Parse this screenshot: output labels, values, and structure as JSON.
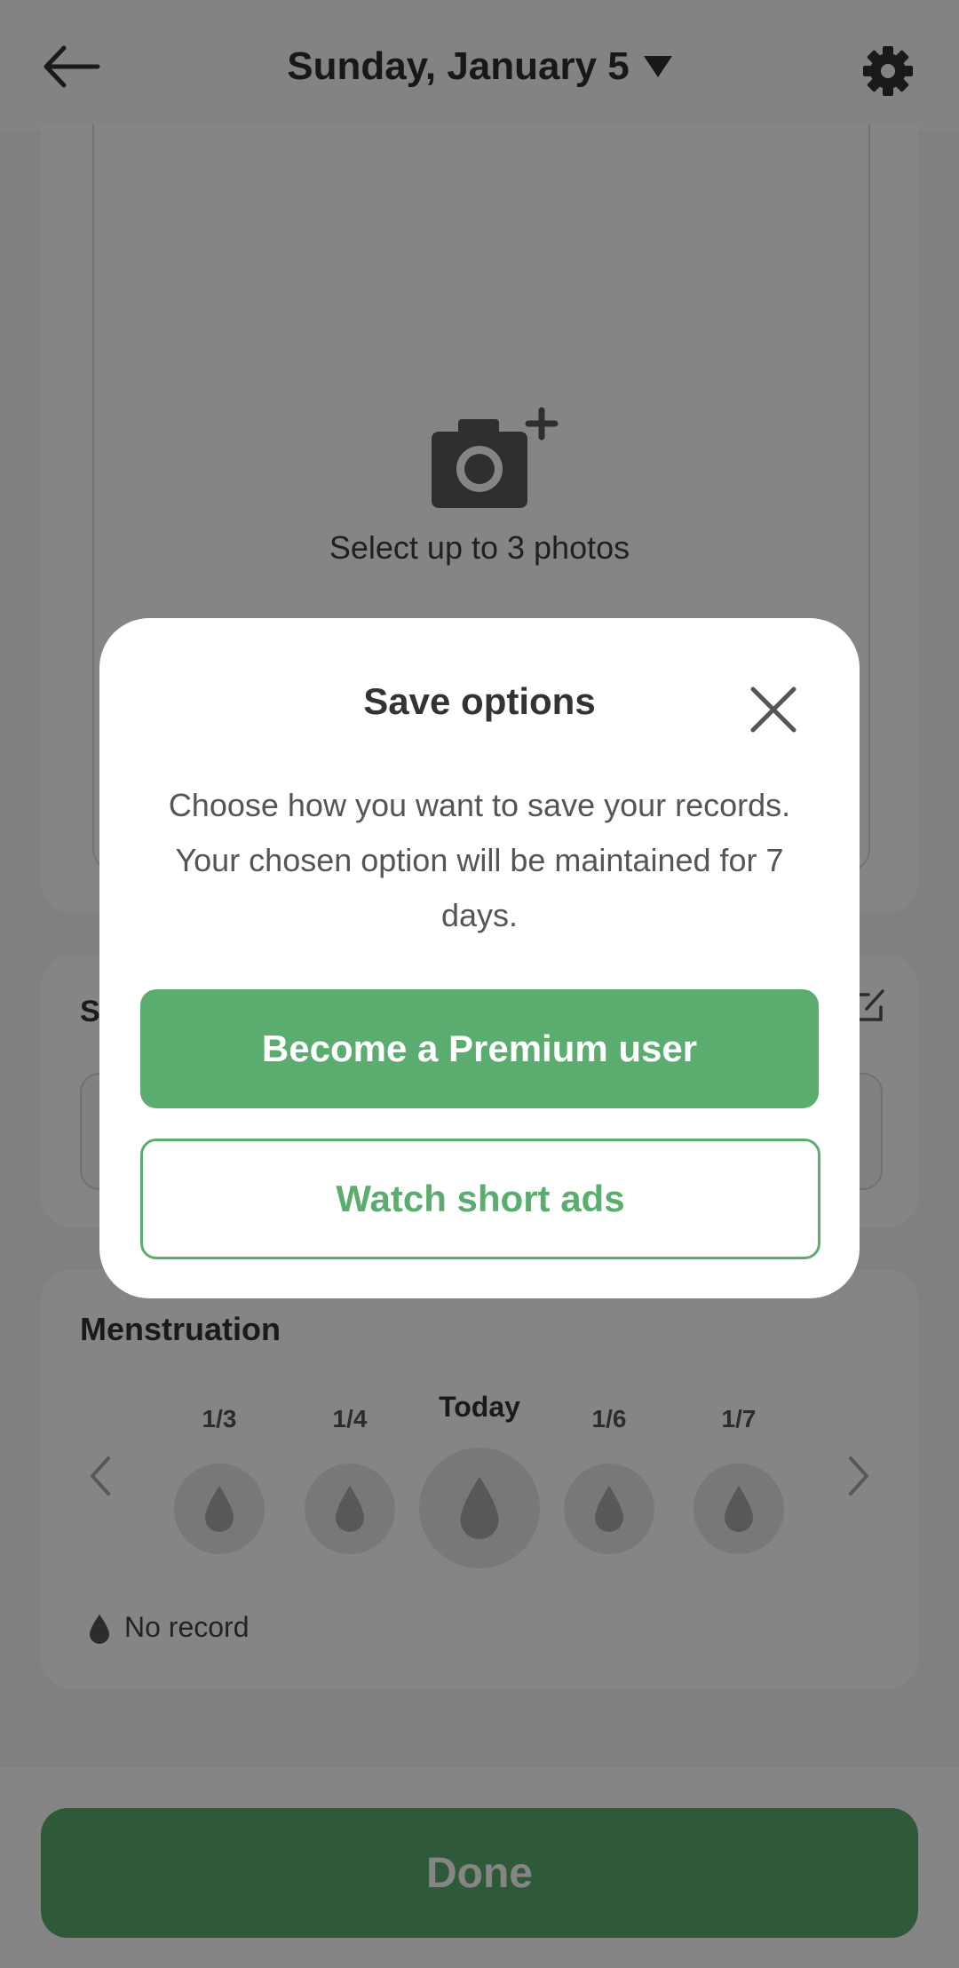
{
  "header": {
    "date_title": "Sunday, January 5"
  },
  "photos": {
    "label": "Select up to 3 photos"
  },
  "section2": {
    "title_visible": "S"
  },
  "menstruation": {
    "title": "Menstruation",
    "days": [
      {
        "label": "1/3",
        "today": false
      },
      {
        "label": "1/4",
        "today": false
      },
      {
        "label": "Today",
        "today": true
      },
      {
        "label": "1/6",
        "today": false
      },
      {
        "label": "1/7",
        "today": false
      }
    ],
    "legend": "No record"
  },
  "footer": {
    "done_label": "Done"
  },
  "modal": {
    "title": "Save options",
    "description": "Choose how you want to save your records. Your chosen option will be maintained for 7 days.",
    "premium_label": "Become a Premium user",
    "ads_label": "Watch short ads"
  },
  "colors": {
    "accent": "#5aad6e",
    "overlay": "rgba(0,0,0,0.48)"
  },
  "icons": {
    "back": "arrow-left-icon",
    "settings": "gear-icon",
    "camera": "camera-plus-icon",
    "close": "close-icon",
    "drop": "drop-icon",
    "edit": "edit-icon",
    "prev": "chevron-left-icon",
    "next": "chevron-right-icon"
  }
}
